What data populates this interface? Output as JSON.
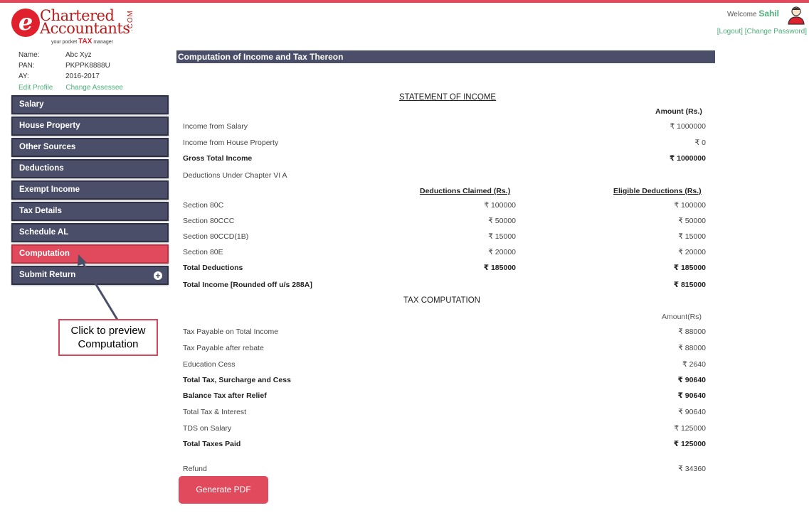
{
  "logo": {
    "line1": "Chartered",
    "line2": "Accountants",
    "com": ".COM",
    "tag_before": "your pocket ",
    "tag_mid": "TAX",
    "tag_after": " manager"
  },
  "assessee": {
    "name_label": "Name:",
    "name": "Abc Xyz",
    "pan_label": "PAN:",
    "pan": "PKPPK8888U",
    "ay_label": "AY:",
    "ay": "2016-2017",
    "edit_profile": "Edit Profile",
    "change_assessee": "Change Assessee"
  },
  "header": {
    "welcome": "Welcome ",
    "user": "Sahil",
    "logout": "[Logout]",
    "change_password": "[Change Password]"
  },
  "sidebar": {
    "items": [
      {
        "label": "Salary"
      },
      {
        "label": "House Property"
      },
      {
        "label": "Other Sources"
      },
      {
        "label": "Deductions"
      },
      {
        "label": "Exempt Income"
      },
      {
        "label": "Tax Details"
      },
      {
        "label": "Schedule AL"
      },
      {
        "label": "Computation"
      },
      {
        "label": "Submit Return"
      }
    ],
    "active_index": 7
  },
  "main": {
    "title": "Computation of Income and Tax Thereon",
    "statement_title": "STATEMENT OF INCOME",
    "amount_head": "Amount (Rs.)",
    "income_from_salary": {
      "label": "Income from Salary",
      "value": "₹ 1000000"
    },
    "income_from_house": {
      "label": "Income from House Property",
      "value": "₹ 0"
    },
    "gross_total": {
      "label": "Gross Total Income",
      "value": "₹ 1000000"
    },
    "deductions_heading": "Deductions Under Chapter VI A",
    "col_claimed": "Deductions Claimed (Rs.)",
    "col_eligible": "Eligible Deductions (Rs.)",
    "sections": [
      {
        "label": "Section 80C",
        "claimed": "₹ 100000",
        "eligible": "₹ 100000"
      },
      {
        "label": "Section 80CCC",
        "claimed": "₹ 50000",
        "eligible": "₹ 50000"
      },
      {
        "label": "Section 80CCD(1B)",
        "claimed": "₹ 15000",
        "eligible": "₹ 15000"
      },
      {
        "label": "Section 80E",
        "claimed": "₹ 20000",
        "eligible": "₹ 20000"
      }
    ],
    "total_deductions": {
      "label": "Total Deductions",
      "claimed": "₹ 185000",
      "eligible": "₹ 185000"
    },
    "total_income": {
      "label": "Total Income [Rounded off u/s 288A]",
      "value": "₹ 815000"
    },
    "tax_title": "TAX COMPUTATION",
    "tax_amount_head": "Amount(Rs)",
    "tax_rows": [
      {
        "label": "Tax Payable on Total Income",
        "value": "₹ 88000",
        "bold": false
      },
      {
        "label": "Tax Payable after rebate",
        "value": "₹ 88000",
        "bold": false
      },
      {
        "label": "Education Cess",
        "value": "₹ 2640",
        "bold": false
      },
      {
        "label": "Total Tax, Surcharge and Cess",
        "value": "₹ 90640",
        "bold": true
      },
      {
        "label": "Balance Tax after Relief",
        "value": "₹ 90640",
        "bold": true
      },
      {
        "label": "Total Tax & Interest",
        "value": "₹ 90640",
        "bold": false
      },
      {
        "label": "TDS on Salary",
        "value": "₹ 125000",
        "bold": false
      },
      {
        "label": "Total Taxes Paid",
        "value": "₹ 125000",
        "bold": true
      }
    ],
    "refund": {
      "label": "Refund",
      "value": "₹ 34360"
    },
    "generate_pdf": "Generate PDF"
  },
  "callout": {
    "text_line1": "Click to preview",
    "text_line2": "Computation"
  }
}
